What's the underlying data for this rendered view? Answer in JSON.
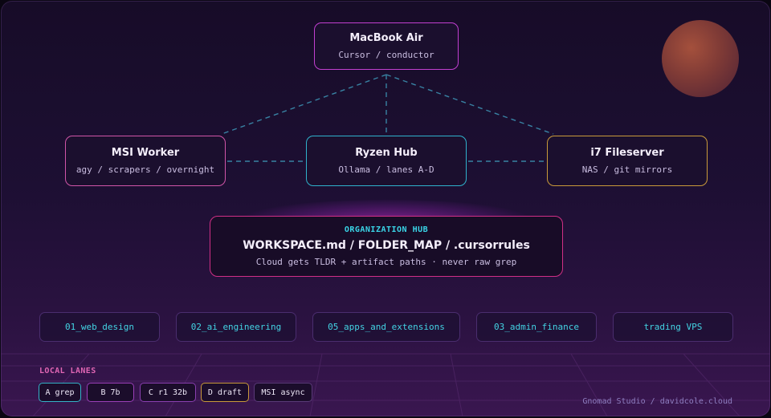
{
  "colors": {
    "background": "#1d0f33",
    "accent_magenta": "#c13fd0",
    "accent_pink": "#d055a8",
    "accent_cyan": "#2fb2cc",
    "accent_gold": "#c99a3a",
    "org_border": "#d02f86",
    "folder_text": "#43d3e3",
    "link_dash": "#3c8fb0"
  },
  "nodes": {
    "macbook": {
      "title": "MacBook Air",
      "subtitle": "Cursor / conductor"
    },
    "msi": {
      "title": "MSI Worker",
      "subtitle": "agy / scrapers / overnight"
    },
    "ryzen": {
      "title": "Ryzen Hub",
      "subtitle": "Ollama / lanes A-D"
    },
    "i7": {
      "title": "i7 Fileserver",
      "subtitle": "NAS / git mirrors"
    }
  },
  "org_hub": {
    "kicker": "ORGANIZATION HUB",
    "title": "WORKSPACE.md / FOLDER_MAP / .cursorrules",
    "subtitle": "Cloud gets TLDR + artifact paths · never raw grep"
  },
  "folders": [
    {
      "label": "01_web_design"
    },
    {
      "label": "02_ai_engineering"
    },
    {
      "label": "05_apps_and_extensions"
    },
    {
      "label": "03_admin_finance"
    },
    {
      "label": "trading VPS"
    }
  ],
  "lanes": {
    "title": "LOCAL LANES",
    "items": [
      {
        "label": "A grep",
        "color": "#35b3c8"
      },
      {
        "label": "B 7b",
        "color": "#9a3fb8"
      },
      {
        "label": "C r1 32b",
        "color": "#8a3fb0"
      },
      {
        "label": "D draft",
        "color": "#c99a3a"
      },
      {
        "label": "MSI async",
        "color": "#5a3a78"
      }
    ]
  },
  "footer": "Gnomad Studio / davidcole.cloud"
}
